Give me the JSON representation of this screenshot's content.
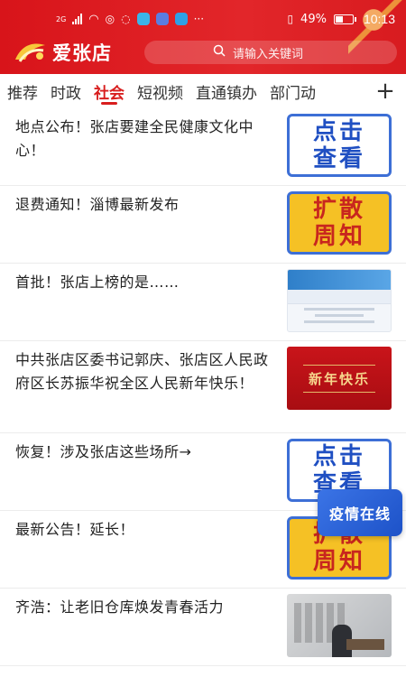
{
  "status_bar": {
    "network": "2G",
    "battery": "49%",
    "time": "10:13"
  },
  "header": {
    "app_name": "爱张店",
    "search_placeholder": "请输入关键词"
  },
  "tabs": [
    {
      "label": "推荐"
    },
    {
      "label": "时政"
    },
    {
      "label": "社会",
      "active": true
    },
    {
      "label": "短视频"
    },
    {
      "label": "直通镇办"
    },
    {
      "label": "部门动"
    }
  ],
  "tab_add": "+",
  "news": [
    {
      "title": "地点公布！张店要建全民健康文化中心！",
      "thumb": {
        "line1": "点击",
        "line2": "查看"
      }
    },
    {
      "title": "退费通知！淄博最新发布",
      "thumb": {
        "line1": "扩散",
        "line2": "周知"
      }
    },
    {
      "title": "首批！张店上榜的是……"
    },
    {
      "title": "中共张店区委书记郭庆、张店区人民政府区长苏振华祝全区人民新年快乐！",
      "thumb": {
        "text": "新年快乐"
      }
    },
    {
      "title": "恢复！涉及张店这些场所→",
      "thumb": {
        "line1": "点击",
        "line2": "查看"
      }
    },
    {
      "title": "最新公告！延长！",
      "thumb": {
        "line1": "扩散",
        "line2": "周知"
      }
    },
    {
      "title": "齐浩：让老旧仓库焕发青春活力"
    }
  ],
  "float_badge": "疫情在线",
  "colors": {
    "brand_red": "#d8141a",
    "active_tab": "#d81e1e",
    "badge_blue": "#1d52c8"
  }
}
